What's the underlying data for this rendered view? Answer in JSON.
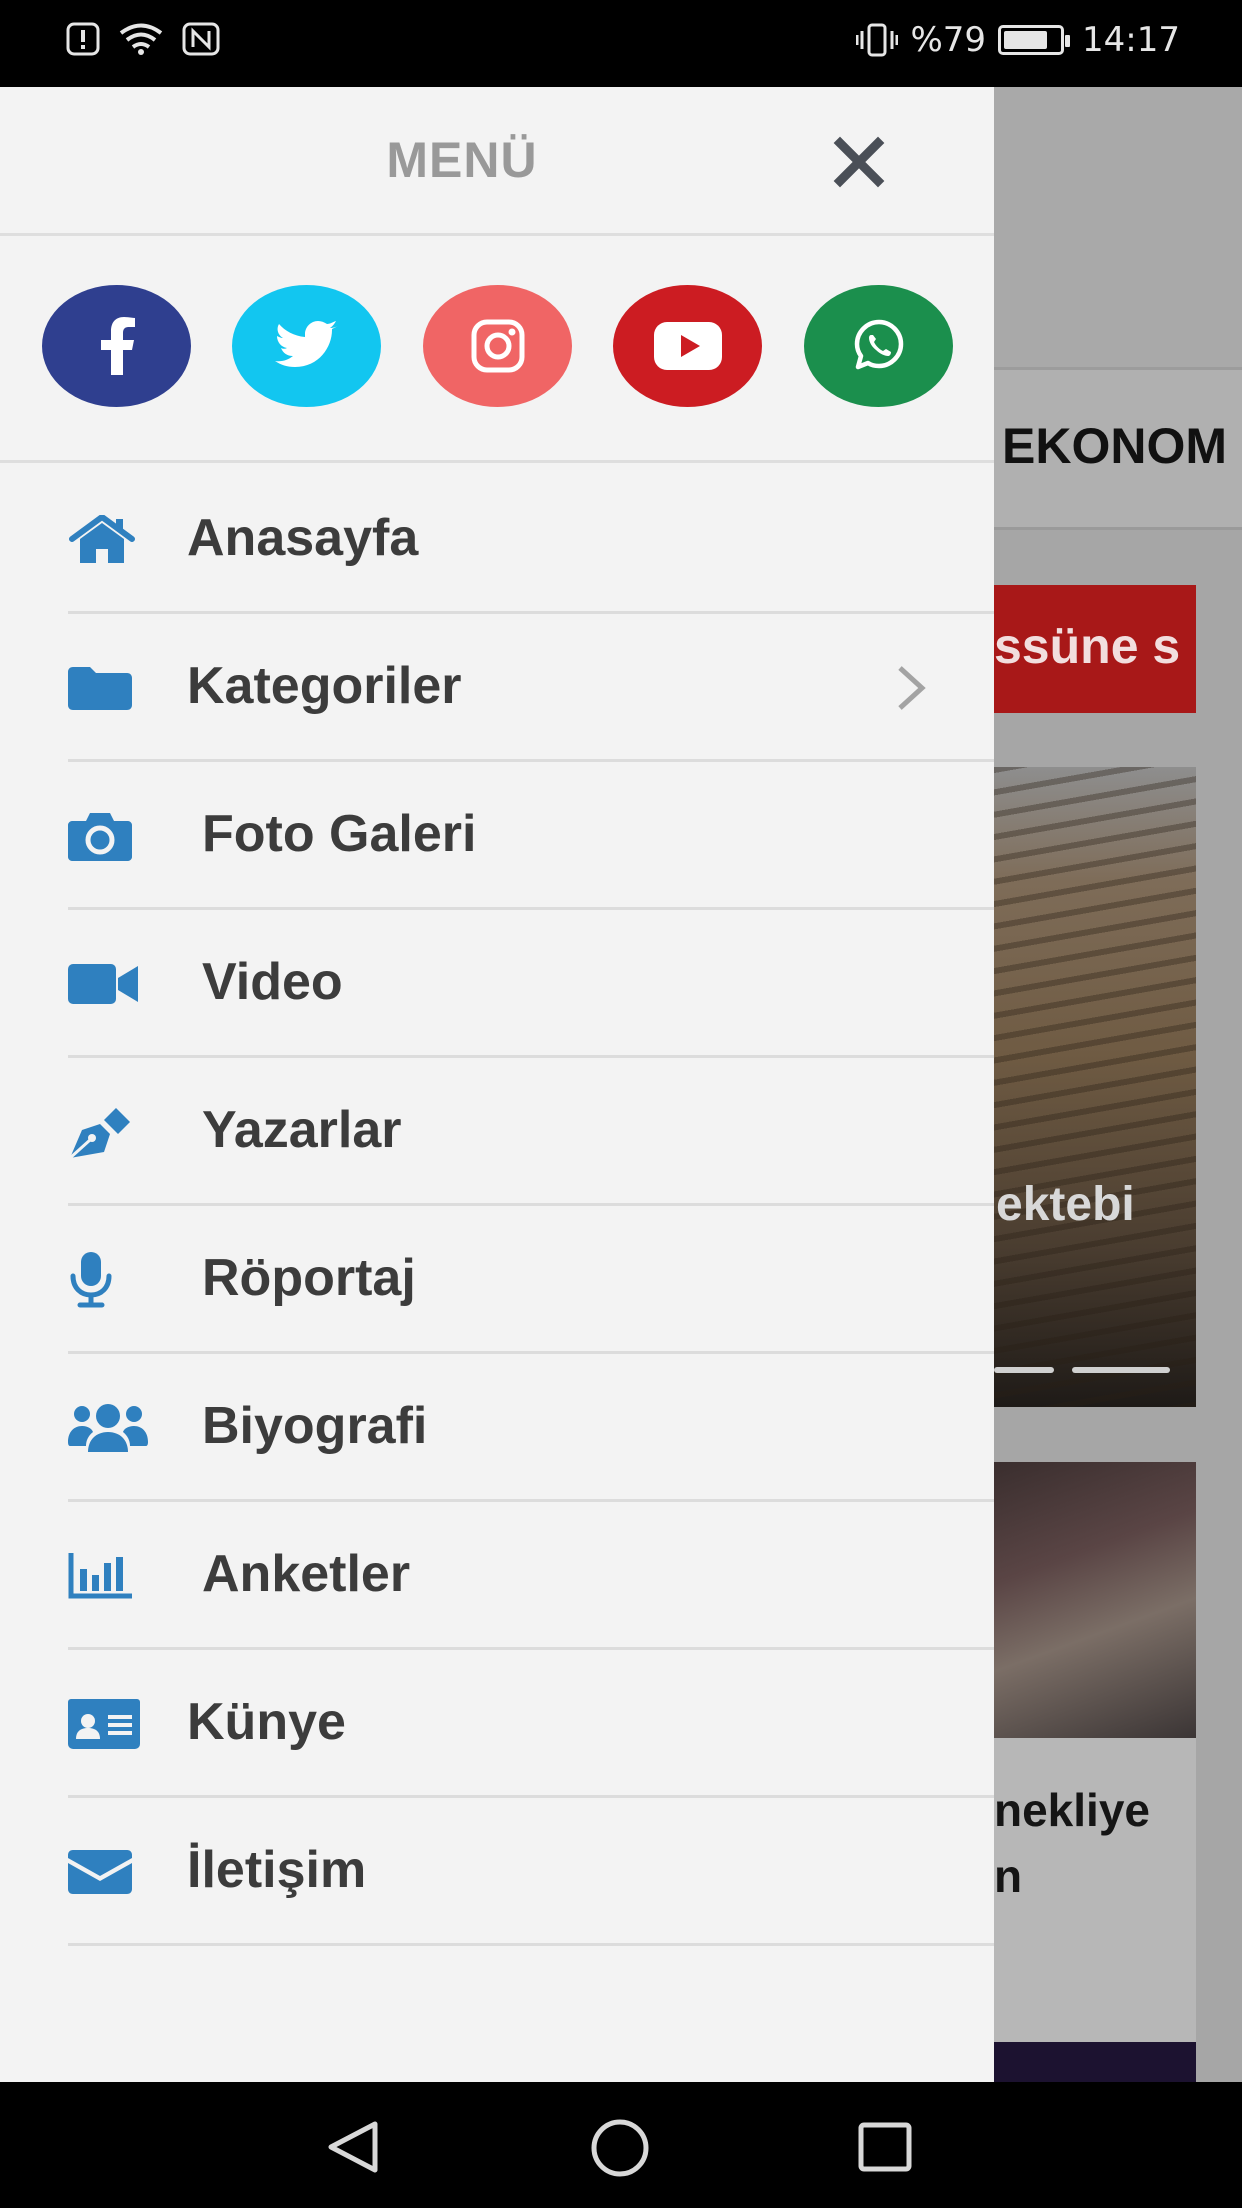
{
  "status_bar": {
    "battery_text": "%79",
    "battery_level": 0.79,
    "time": "14:17",
    "left_icons": [
      "alert-icon",
      "wifi-icon",
      "nfc-icon"
    ],
    "right_icons": [
      "vibrate-icon",
      "battery-icon"
    ]
  },
  "drawer": {
    "title": "MENÜ",
    "close_icon": "close-icon",
    "social": [
      {
        "name": "facebook",
        "color": "#2f3f8f"
      },
      {
        "name": "twitter",
        "color": "#12c6f0"
      },
      {
        "name": "instagram",
        "color": "#f06565"
      },
      {
        "name": "youtube",
        "color": "#cc1c22"
      },
      {
        "name": "whatsapp",
        "color": "#1b8f4d"
      }
    ],
    "items": [
      {
        "label": "Anasayfa",
        "icon": "home-icon"
      },
      {
        "label": "Kategoriler",
        "icon": "folder-icon",
        "has_submenu": true
      },
      {
        "label": "Foto Galeri",
        "icon": "camera-icon"
      },
      {
        "label": "Video",
        "icon": "video-camera-icon"
      },
      {
        "label": "Yazarlar",
        "icon": "pen-icon"
      },
      {
        "label": "Röportaj",
        "icon": "microphone-icon"
      },
      {
        "label": "Biyografi",
        "icon": "users-icon"
      },
      {
        "label": "Anketler",
        "icon": "poll-chart-icon"
      },
      {
        "label": "Künye",
        "icon": "id-card-icon"
      },
      {
        "label": "İletişim",
        "icon": "envelope-icon"
      }
    ],
    "accent_color": "#2f80bf"
  },
  "background_app": {
    "category_text": "EKONOM",
    "ticker_text": "ssüne s",
    "slider_caption": "ektebi",
    "card_title_line1": "nekliye",
    "card_title_line2": "n"
  },
  "nav_bar": {
    "buttons": [
      "back-icon",
      "home-circle-icon",
      "recents-icon"
    ]
  }
}
